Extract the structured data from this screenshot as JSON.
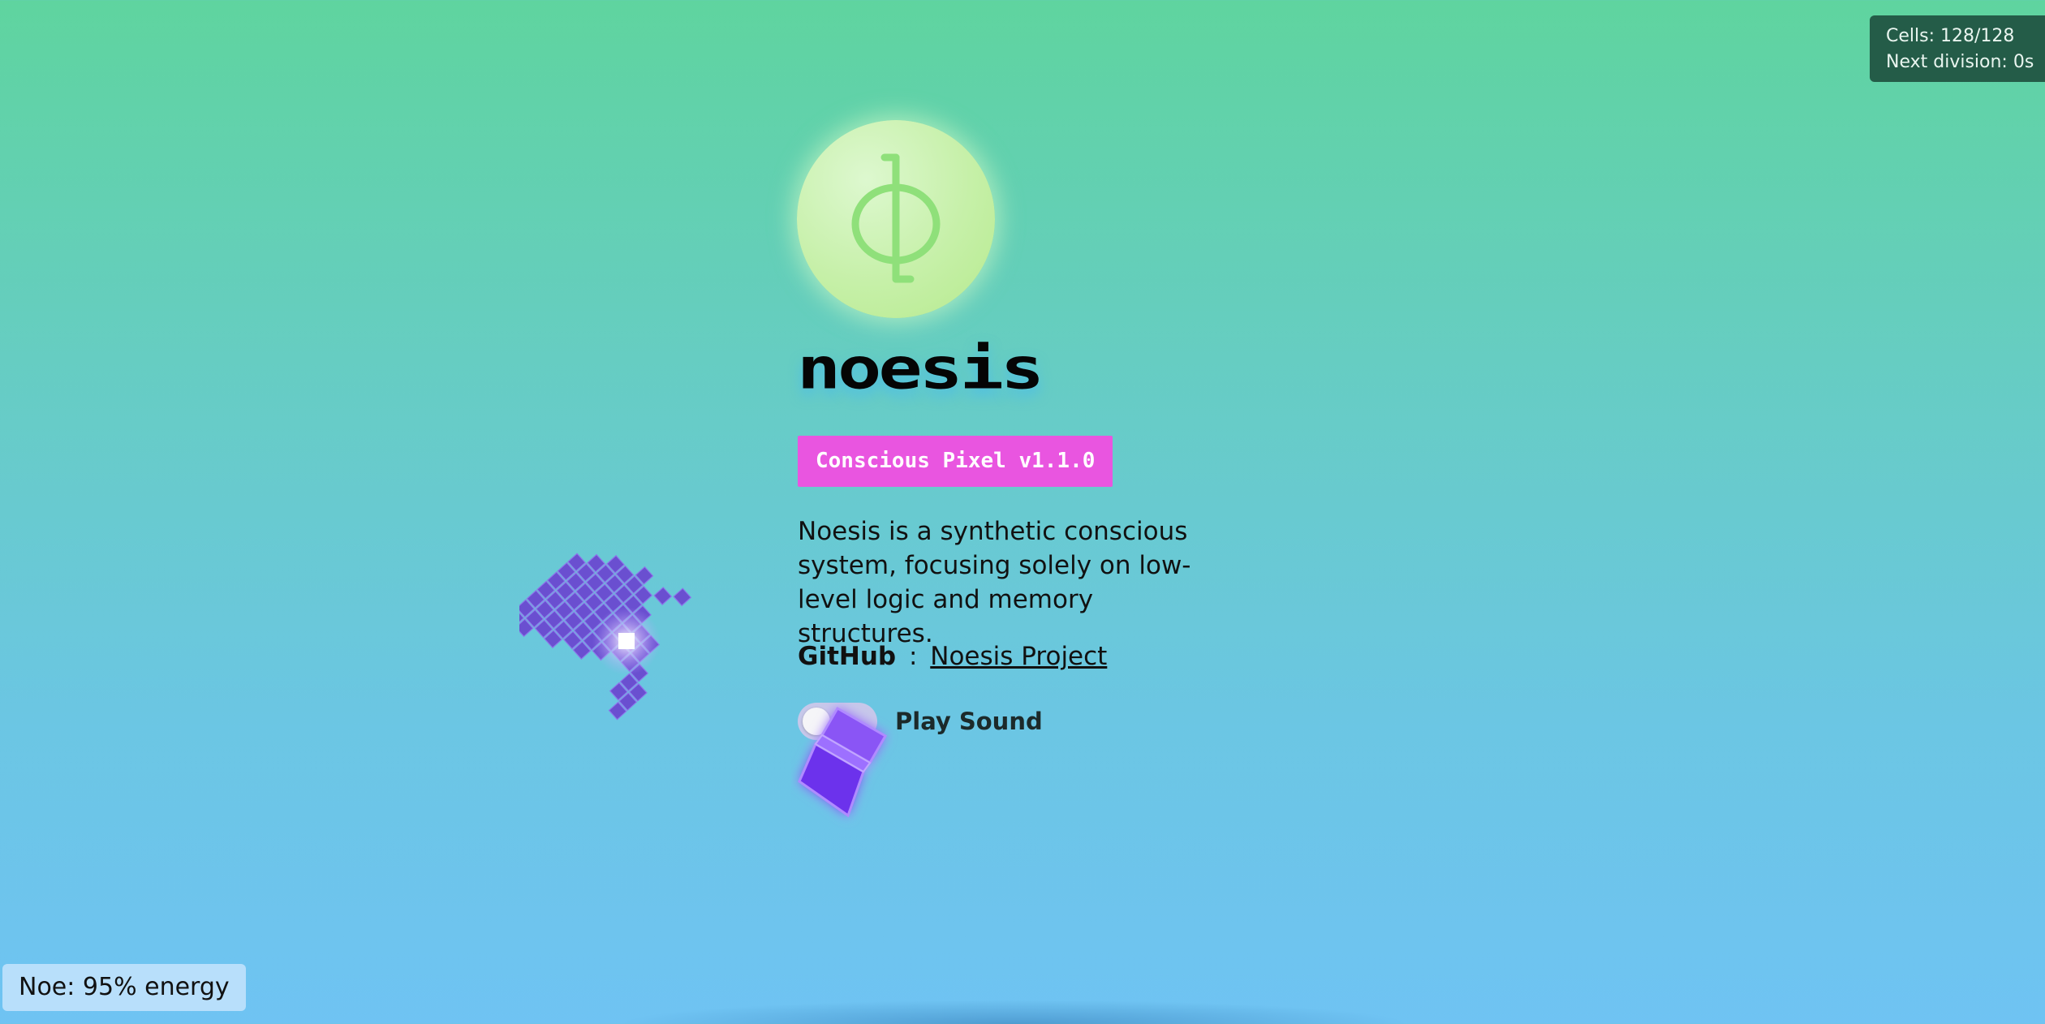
{
  "status": {
    "cells": "Cells: 128/128",
    "next_division": "Next division: 0s"
  },
  "logo": {
    "symbol": "ϕ",
    "icon": "phi-logo-icon"
  },
  "brand": {
    "name": "noesis",
    "version_badge": "Conscious Pixel v1.1.0"
  },
  "description": "Noesis is a synthetic conscious system, focusing solely on low-level logic and memory structures.",
  "github": {
    "label": "GitHub",
    "separator": ":",
    "link_text": "Noesis Project"
  },
  "sound": {
    "label": "Play Sound",
    "enabled": false
  },
  "energy": {
    "text": "Noe: 95% energy",
    "level": 0.95
  },
  "colors": {
    "badge": "#e955e0",
    "pixel": "#6a4fd0",
    "cube": "#7a3cf0",
    "status_panel": "#245c48"
  },
  "decorations": {
    "pixel_cluster_icon": "pixel-cluster-icon",
    "cube_creature_icon": "cube-creature-icon"
  }
}
